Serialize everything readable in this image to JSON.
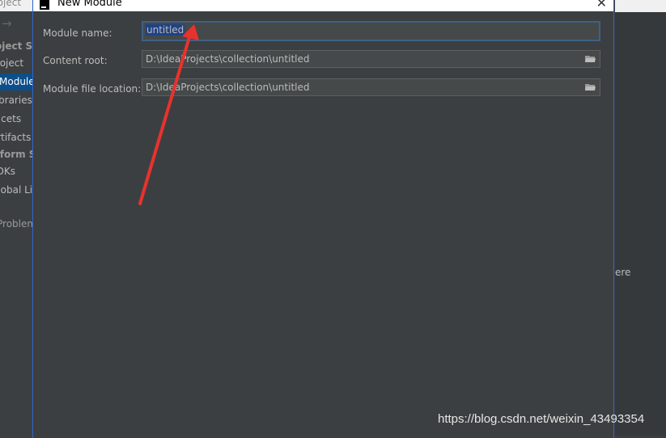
{
  "background": {
    "window_title_partial": "roject",
    "sidebar_items": [
      {
        "label": "oject Str",
        "type": "header"
      },
      {
        "label": "Project",
        "type": "item"
      },
      {
        "label": "Modules",
        "type": "selected"
      },
      {
        "label": "Libraries",
        "type": "item"
      },
      {
        "label": "Facets",
        "type": "item"
      },
      {
        "label": "Artifacts",
        "type": "item"
      },
      {
        "label": "tform S",
        "type": "header"
      },
      {
        "label": "SDKs",
        "type": "item"
      },
      {
        "label": "Global Li",
        "type": "item"
      },
      {
        "label": "Problems",
        "type": "problems"
      }
    ],
    "right_partial_text": "ere"
  },
  "dialog": {
    "title": "New Module",
    "close_icon": "close-icon",
    "fields": {
      "module_name": {
        "label": "Module name:",
        "value": "untitled"
      },
      "content_root": {
        "label": "Content root:",
        "value": "D:\\IdeaProjects\\collection\\untitled"
      },
      "module_file_location": {
        "label": "Module file location:",
        "value": "D:\\IdeaProjects\\collection\\untitled"
      }
    }
  },
  "watermark": "https://blog.csdn.net/weixin_43493354",
  "colors": {
    "accent": "#2f65ca",
    "selection": "#214283",
    "annotation_arrow": "#e8322d"
  }
}
